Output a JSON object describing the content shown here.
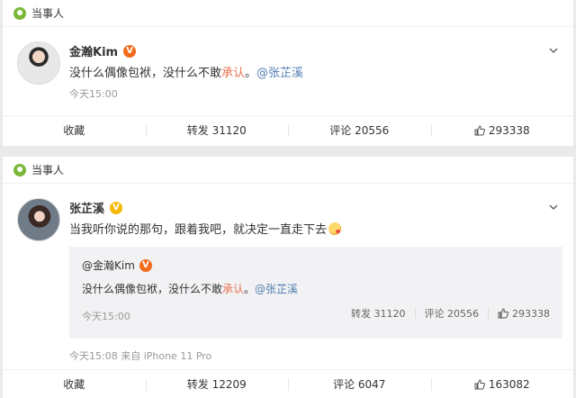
{
  "card1": {
    "header_label": "当事人",
    "user_name": "金瀚Kim",
    "badge": "V",
    "text_prefix": "没什么偶像包袱，没什么不敢",
    "text_highlight": "承认",
    "text_suffix": "。",
    "mention": "@张芷溪",
    "time": "今天15:00",
    "actions": {
      "favorite": "收藏",
      "repost": "转发 31120",
      "comment": "评论 20556",
      "like": "293338"
    }
  },
  "card2": {
    "header_label": "当事人",
    "user_name": "张芷溪",
    "badge": "V",
    "text": "当我听你说的那句，跟着我吧，就决定一直走下去",
    "repost": {
      "user_name": "@金瀚Kim",
      "badge": "V",
      "text_prefix": "没什么偶像包袱，没什么不敢",
      "text_highlight": "承认",
      "text_suffix": "。",
      "mention": "@张芷溪",
      "time": "今天15:00",
      "repost_count": "转发 31120",
      "comment_count": "评论 20556",
      "like_count": "293338"
    },
    "time": "今天15:08  来自 iPhone 11 Pro",
    "actions": {
      "favorite": "收藏",
      "repost": "转发 12209",
      "comment": "评论 6047",
      "like": "163082"
    }
  },
  "colors": {
    "accent_orange": "#eb7350",
    "link_blue": "#507daf",
    "pin_green": "#7ab839"
  }
}
